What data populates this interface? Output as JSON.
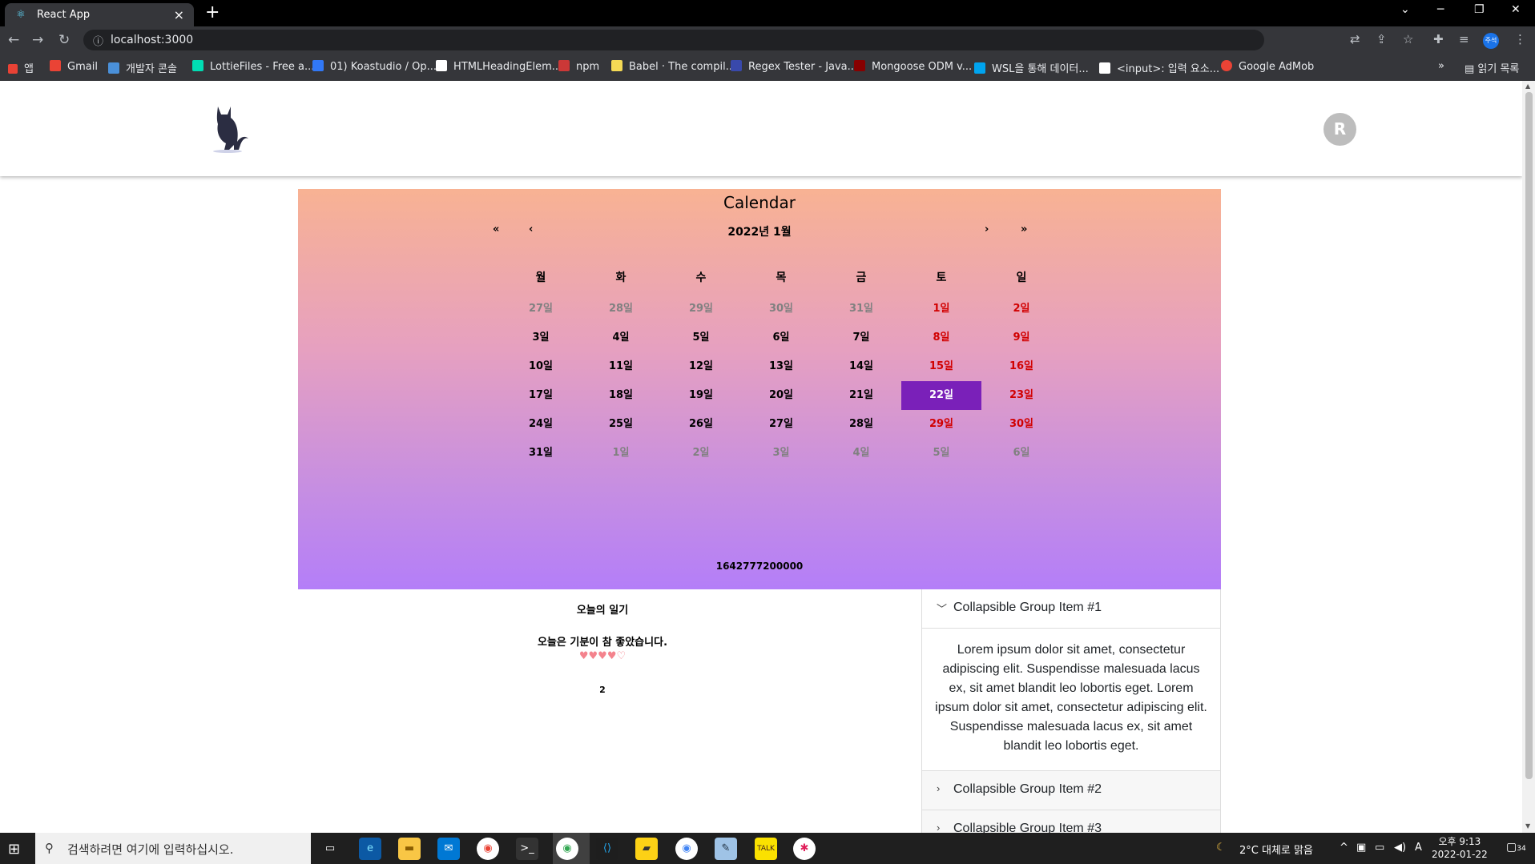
{
  "browser": {
    "tab_title": "React App",
    "url": "localhost:3000",
    "bookmarks": [
      {
        "label": "앱",
        "color": "#e94235"
      },
      {
        "label": "Gmail",
        "color": "#ea4335"
      },
      {
        "label": "개발자 콘솔",
        "color": "#4a90d9"
      },
      {
        "label": "LottieFiles - Free a...",
        "color": "#00ddb3"
      },
      {
        "label": "01) Koastudio / Op...",
        "color": "#3178f6"
      },
      {
        "label": "HTMLHeadingElem...",
        "color": "#ffffff"
      },
      {
        "label": "npm",
        "color": "#cb3837"
      },
      {
        "label": "Babel · The compil...",
        "color": "#f5da55"
      },
      {
        "label": "Regex Tester - Java...",
        "color": "#3949ab"
      },
      {
        "label": "Mongoose ODM v...",
        "color": "#880000"
      },
      {
        "label": "WSL을 통해 데이터...",
        "color": "#00a4ef"
      },
      {
        "label": "<input>: 입력 요소...",
        "color": "#ffffff"
      },
      {
        "label": "Google AdMob",
        "color": "#ea4335"
      }
    ],
    "reading_list": "읽기 목록",
    "profile_label": "주석"
  },
  "header": {
    "avatar_letter": "R"
  },
  "calendar": {
    "title": "Calendar",
    "nav": {
      "prev_year": "«",
      "prev_month": "‹",
      "next_month": "›",
      "next_year": "»"
    },
    "month_label": "2022년 1월",
    "weekdays": [
      "월",
      "화",
      "수",
      "목",
      "금",
      "토",
      "일"
    ],
    "weeks": [
      [
        {
          "d": "27일",
          "t": "muted"
        },
        {
          "d": "28일",
          "t": "muted"
        },
        {
          "d": "29일",
          "t": "muted"
        },
        {
          "d": "30일",
          "t": "muted"
        },
        {
          "d": "31일",
          "t": "muted"
        },
        {
          "d": "1일",
          "t": "weekend"
        },
        {
          "d": "2일",
          "t": "weekend"
        }
      ],
      [
        {
          "d": "3일",
          "t": "normal"
        },
        {
          "d": "4일",
          "t": "normal"
        },
        {
          "d": "5일",
          "t": "normal"
        },
        {
          "d": "6일",
          "t": "normal"
        },
        {
          "d": "7일",
          "t": "normal"
        },
        {
          "d": "8일",
          "t": "weekend"
        },
        {
          "d": "9일",
          "t": "weekend"
        }
      ],
      [
        {
          "d": "10일",
          "t": "normal"
        },
        {
          "d": "11일",
          "t": "normal"
        },
        {
          "d": "12일",
          "t": "normal"
        },
        {
          "d": "13일",
          "t": "normal"
        },
        {
          "d": "14일",
          "t": "normal"
        },
        {
          "d": "15일",
          "t": "weekend"
        },
        {
          "d": "16일",
          "t": "weekend"
        }
      ],
      [
        {
          "d": "17일",
          "t": "normal"
        },
        {
          "d": "18일",
          "t": "normal"
        },
        {
          "d": "19일",
          "t": "normal"
        },
        {
          "d": "20일",
          "t": "normal"
        },
        {
          "d": "21일",
          "t": "normal"
        },
        {
          "d": "22일",
          "t": "selected"
        },
        {
          "d": "23일",
          "t": "weekend"
        }
      ],
      [
        {
          "d": "24일",
          "t": "normal"
        },
        {
          "d": "25일",
          "t": "normal"
        },
        {
          "d": "26일",
          "t": "normal"
        },
        {
          "d": "27일",
          "t": "normal"
        },
        {
          "d": "28일",
          "t": "normal"
        },
        {
          "d": "29일",
          "t": "weekend"
        },
        {
          "d": "30일",
          "t": "weekend"
        }
      ],
      [
        {
          "d": "31일",
          "t": "normal"
        },
        {
          "d": "1일",
          "t": "muted"
        },
        {
          "d": "2일",
          "t": "muted"
        },
        {
          "d": "3일",
          "t": "muted"
        },
        {
          "d": "4일",
          "t": "muted"
        },
        {
          "d": "5일",
          "t": "muted"
        },
        {
          "d": "6일",
          "t": "muted"
        }
      ]
    ],
    "timestamp": "1642777200000"
  },
  "diary": {
    "title": "오늘의 일기",
    "body": "오늘은 기분이 참 좋았습니다.",
    "hearts": "♥♥♥♥♡",
    "rating": 4.5,
    "count": "2"
  },
  "accordion": [
    {
      "label": "Collapsible Group Item #1",
      "open": true,
      "body": "Lorem ipsum dolor sit amet, consectetur adipiscing elit. Suspendisse malesuada lacus ex, sit amet blandit leo lobortis eget. Lorem ipsum dolor sit amet, consectetur adipiscing elit. Suspendisse malesuada lacus ex, sit amet blandit leo lobortis eget."
    },
    {
      "label": "Collapsible Group Item #2",
      "open": false
    },
    {
      "label": "Collapsible Group Item #3",
      "open": false
    }
  ],
  "taskbar": {
    "search_placeholder": "검색하려면 여기에 입력하십시오.",
    "weather": "2°C  대체로 맑음",
    "time": "오후 9:13",
    "date": "2022-01-22",
    "notifications": "34"
  },
  "colors": {
    "selected_day": "#7a20b9",
    "weekend": "#d10000",
    "muted_day": "#808080"
  }
}
